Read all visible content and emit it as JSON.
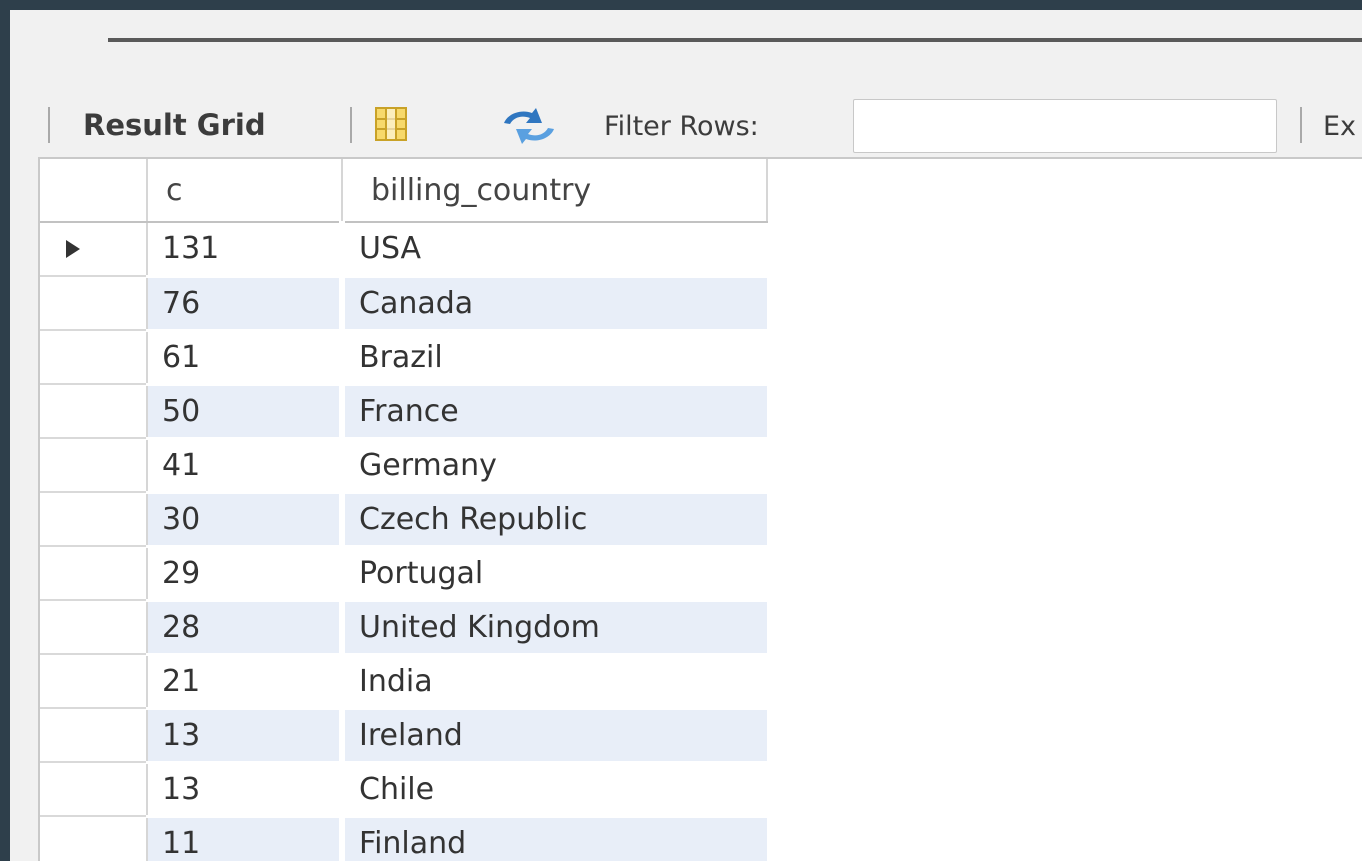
{
  "toolbar": {
    "result_grid_label": "Result Grid",
    "grid_icon": "grid-layout-icon",
    "refresh_icon": "refresh-icon",
    "filter_label": "Filter Rows:",
    "filter_value": "",
    "export_label": "Ex"
  },
  "grid": {
    "columns": [
      "c",
      "billing_country"
    ],
    "rows": [
      {
        "c": "131",
        "billing_country": "USA"
      },
      {
        "c": "76",
        "billing_country": "Canada"
      },
      {
        "c": "61",
        "billing_country": "Brazil"
      },
      {
        "c": "50",
        "billing_country": "France"
      },
      {
        "c": "41",
        "billing_country": "Germany"
      },
      {
        "c": "30",
        "billing_country": "Czech Republic"
      },
      {
        "c": "29",
        "billing_country": "Portugal"
      },
      {
        "c": "28",
        "billing_country": "United Kingdom"
      },
      {
        "c": "21",
        "billing_country": "India"
      },
      {
        "c": "13",
        "billing_country": "Ireland"
      },
      {
        "c": "13",
        "billing_country": "Chile"
      },
      {
        "c": "11",
        "billing_country": "Finland"
      }
    ],
    "selected_row_index": 0
  },
  "colors": {
    "background_frame": "#2e3f4b",
    "alt_row": "#e8eef8",
    "refresh_blue": "#2f76c0"
  }
}
